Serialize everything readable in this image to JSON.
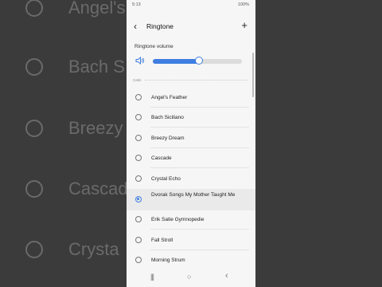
{
  "status": {
    "time": "5:13",
    "icons": "▲ ●",
    "battery": "100%"
  },
  "header": {
    "title": "Ringtone",
    "back_icon": "‹",
    "add_icon": "+"
  },
  "volume": {
    "label": "Ringtone volume",
    "level": 0.52
  },
  "section": "Calm",
  "items": [
    {
      "label": "Angel's Feather",
      "selected": false
    },
    {
      "label": "Bach Siciliano",
      "selected": false
    },
    {
      "label": "Breezy Dream",
      "selected": false
    },
    {
      "label": "Cascade",
      "selected": false
    },
    {
      "label": "Crystal Echo",
      "selected": false
    },
    {
      "label": "Dvorak Songs My Mother Taught Me",
      "selected": true
    },
    {
      "label": "Erik Satie Gymnopedie",
      "selected": false
    },
    {
      "label": "Fall Stroll",
      "selected": false
    },
    {
      "label": "Morning Strum",
      "selected": false
    }
  ],
  "background": {
    "labels": [
      "Angel's",
      "Bach S",
      "Breezy",
      "Cascad",
      "Crysta"
    ]
  },
  "nav": {
    "recents": "|||",
    "home": "○",
    "back": "‹"
  },
  "colors": {
    "accent": "#3f7ee0"
  }
}
